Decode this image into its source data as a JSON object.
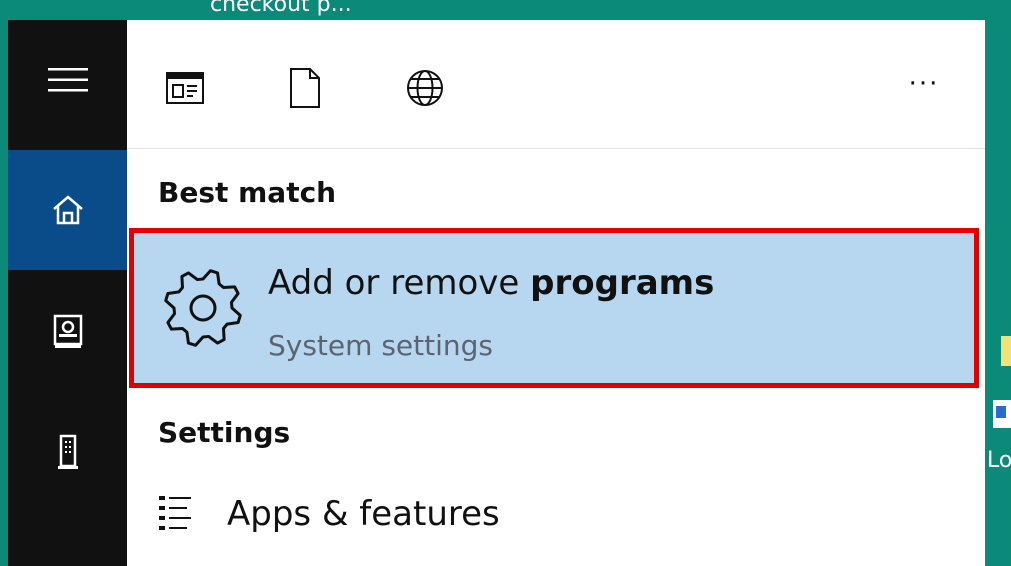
{
  "background": {
    "top_truncated_text": "checkout p...",
    "right_edge_text": "Lo"
  },
  "nav": {
    "items": [
      {
        "name": "menu",
        "icon": "hamburger-icon"
      },
      {
        "name": "home",
        "icon": "home-icon",
        "active": true
      },
      {
        "name": "notebook",
        "icon": "notebook-icon"
      },
      {
        "name": "devices",
        "icon": "tower-icon"
      }
    ]
  },
  "toolbar": {
    "filters": [
      {
        "name": "apps",
        "icon": "app-window-icon"
      },
      {
        "name": "documents",
        "icon": "document-icon"
      },
      {
        "name": "web",
        "icon": "globe-icon"
      }
    ],
    "more_label": "···"
  },
  "results": {
    "best_match": {
      "header": "Best match",
      "title_prefix": "Add or remove",
      "title_bold": "programs",
      "subtitle": "System settings",
      "icon": "gear-icon"
    },
    "settings": {
      "header": "Settings",
      "items": [
        {
          "label": "Apps & features",
          "icon": "list-icon"
        }
      ]
    }
  },
  "colors": {
    "nav_bg": "#111111",
    "nav_active": "#0a4b89",
    "result_bg": "#b7d6f0",
    "highlight_border": "#e20000",
    "desktop_bg": "#0b8a7a"
  }
}
